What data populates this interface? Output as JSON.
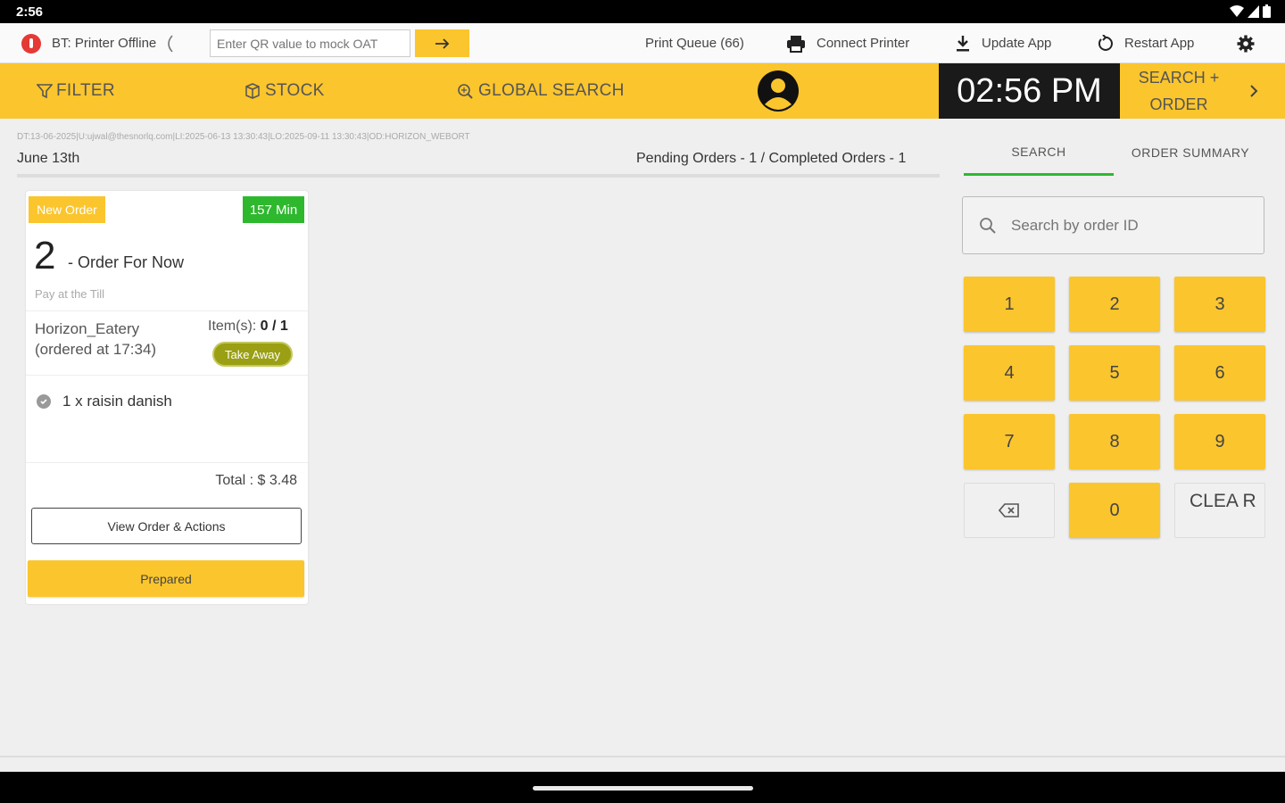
{
  "status_bar": {
    "time": "2:56"
  },
  "toolbar": {
    "printer_status": "BT: Printer Offline",
    "qr_placeholder": "Enter QR value to mock OAT",
    "print_queue": "Print Queue (66)",
    "connect_printer": "Connect Printer",
    "update_app": "Update App",
    "restart_app": "Restart App"
  },
  "nav": {
    "filter": "FILTER",
    "stock": "STOCK",
    "global_search": "GLOBAL SEARCH",
    "clock": "02:56 PM",
    "search_order_line1": "SEARCH +",
    "search_order_line2": "ORDER"
  },
  "main": {
    "info_line": "DT:13-06-2025|U:ujwal@thesnorlq.com|LI:2025-06-13 13:30:43|LO:2025-09-11 13:30:43|OD:HORIZON_WEBORT",
    "date": "June 13th",
    "orders_summary": "Pending Orders - 1 / Completed Orders - 1"
  },
  "order_card": {
    "status_badge": "New Order",
    "elapsed": "157 Min",
    "order_number": "2",
    "order_type": "- Order For Now",
    "payment_note": "Pay at the Till",
    "vendor": "Horizon_Eatery",
    "ordered_at": "(ordered at 17:34)",
    "items_label": "Item(s):",
    "items_value": "0 / 1",
    "service_type": "Take Away",
    "line_items": [
      "1 x raisin danish"
    ],
    "total": "Total : $ 3.48",
    "view_button": "View Order & Actions",
    "prepared_button": "Prepared"
  },
  "right_panel": {
    "tab_search": "SEARCH",
    "tab_summary": "ORDER SUMMARY",
    "search_placeholder": "Search by order ID",
    "keypad": [
      "1",
      "2",
      "3",
      "4",
      "5",
      "6",
      "7",
      "8",
      "9",
      "0"
    ],
    "clear_label": "CLEA R"
  },
  "colors": {
    "accent": "#fbc52d",
    "success": "#2eb82e",
    "danger": "#e53935",
    "takeaway": "#9a9f14"
  }
}
